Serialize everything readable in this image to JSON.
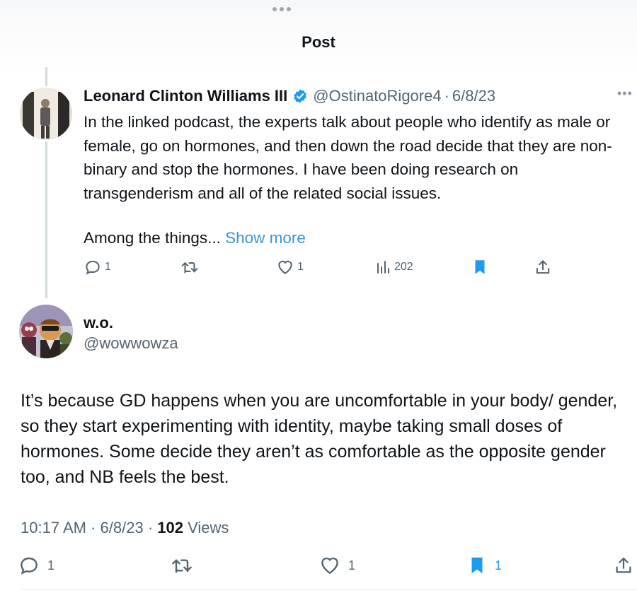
{
  "header": {
    "title": "Post"
  },
  "original_post": {
    "display_name": "Leonard Clinton Williams III",
    "handle": "@OstinatoRigore4",
    "separator": "·",
    "date": "6/8/23",
    "text": "In the linked podcast, the experts talk about people who identify as male or female, go on hormones, and then down the road decide that they are non-binary and stop the hormones. I have been doing research on transgenderism and all of the related social issues.",
    "text_truncated": "Among the things...",
    "show_more": "Show more",
    "actions": {
      "replies": "1",
      "likes": "1",
      "views": "202"
    },
    "icons": [
      "verified-badge-icon",
      "more-icon",
      "reply-icon",
      "retweet-icon",
      "like-icon",
      "views-icon",
      "bookmark-icon",
      "share-icon"
    ]
  },
  "reply": {
    "display_name": "w.o.",
    "handle": "@wowwowza",
    "text": "It’s because GD happens when you are uncomfortable in your body/ gender, so they start experimenting with identity, maybe taking small doses of hormones. Some decide they aren’t as comfortable as the opposite gender too, and NB feels the best.",
    "time": "10:17 AM",
    "separator": "·",
    "date": "6/8/23",
    "views_count": "102",
    "views_label": "Views",
    "actions": {
      "replies": "1",
      "likes": "1",
      "bookmarks": "1"
    }
  },
  "colors": {
    "accent": "#1d9bf0",
    "link": "#3b94d9",
    "secondary_text": "#536471",
    "thread_line": "#cfd9de"
  }
}
